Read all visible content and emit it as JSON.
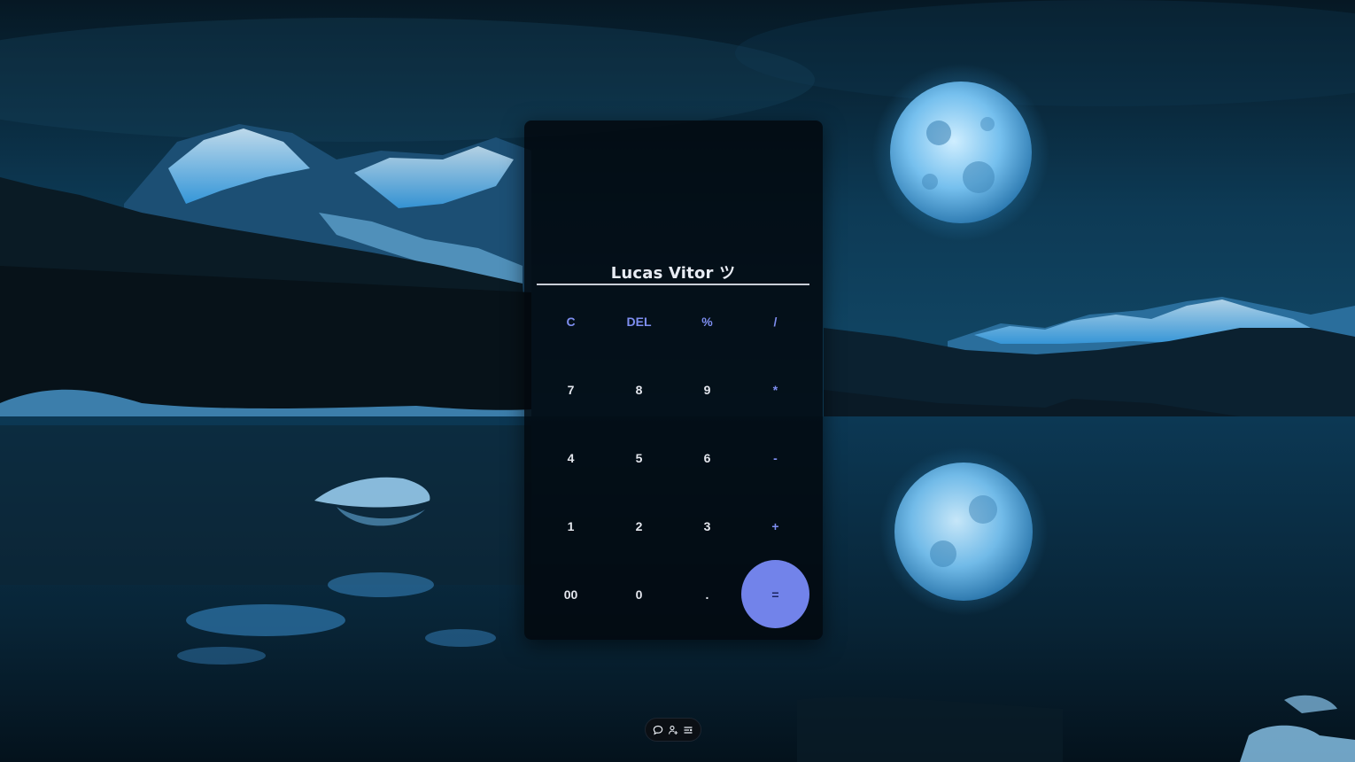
{
  "background": {
    "description_icon": "night-lake-moon-wallpaper-icon",
    "colors": {
      "sky": "#0b3148",
      "water": "#0a2c44",
      "moon": "#7fc4ee",
      "snow": "#6fc3ff"
    }
  },
  "calculator": {
    "display_value": "Lucas Vitor ツ",
    "keys": [
      {
        "label": "C",
        "type": "op"
      },
      {
        "label": "DEL",
        "type": "op"
      },
      {
        "label": "%",
        "type": "op"
      },
      {
        "label": "/",
        "type": "op"
      },
      {
        "label": "7",
        "type": "num"
      },
      {
        "label": "8",
        "type": "num"
      },
      {
        "label": "9",
        "type": "num"
      },
      {
        "label": "*",
        "type": "op"
      },
      {
        "label": "4",
        "type": "num"
      },
      {
        "label": "5",
        "type": "num"
      },
      {
        "label": "6",
        "type": "num"
      },
      {
        "label": "-",
        "type": "op"
      },
      {
        "label": "1",
        "type": "num"
      },
      {
        "label": "2",
        "type": "num"
      },
      {
        "label": "3",
        "type": "num"
      },
      {
        "label": "+",
        "type": "op"
      },
      {
        "label": "00",
        "type": "num"
      },
      {
        "label": "0",
        "type": "num"
      },
      {
        "label": ".",
        "type": "num"
      },
      {
        "label": "=",
        "type": "equals"
      }
    ],
    "accent_color": "#7283ea"
  },
  "taskbar": {
    "icons": [
      "chat-bubble-icon",
      "person-add-icon",
      "menu-settings-icon"
    ]
  }
}
